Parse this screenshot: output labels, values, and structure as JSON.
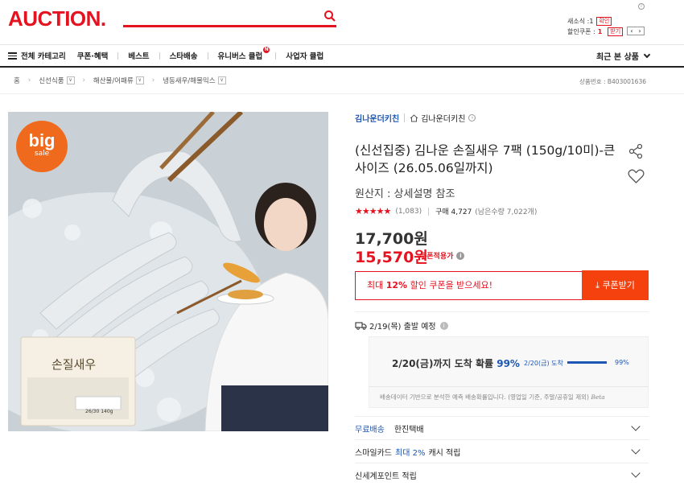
{
  "header": {
    "logo": "AUCTION.",
    "cart_label": "새소식 : ",
    "cart_count": "1",
    "cart_btn": "확인",
    "coupon_label": "할인쿠폰 : ",
    "coupon_count": "1",
    "coupon_btn": "받기"
  },
  "nav": {
    "all_category": "전체 카테고리",
    "items": [
      "쿠폰·혜택",
      "베스트",
      "스타배송",
      "유니버스 클럽",
      "사업자 클럽"
    ],
    "club_badge": "N",
    "recent": "최근 본 상품"
  },
  "breadcrumb": {
    "home": "홈",
    "items": [
      "신선식품",
      "해산물/어패류",
      "냉동새우/해물믹스"
    ],
    "product_no": "상품번호 : B403001636"
  },
  "hero": {
    "badge_big": "big",
    "badge_sale": "sale",
    "package_label": "손질새우",
    "package_sub": "26/30 140g"
  },
  "product": {
    "seller_name": "김나운더키친",
    "store_name": "김나운더키친",
    "title": "(신선집중) 김나운 손질새우 7팩 (150g/10미)-큰사이즈 (26.05.06일까지)",
    "origin": "원산지 : 상세설명 참조",
    "stars": "★★★★★",
    "review_count": "(1,083)",
    "purchase": "구매 4,727",
    "stock": "(남은수량 7,022개)",
    "price": "17,700원",
    "sale_price": "15,570원",
    "coupon_applied": "쿠폰적용가"
  },
  "coupon": {
    "prefix": "최대 ",
    "pct": "12%",
    "suffix": " 할인 쿠폰을 받으세요!",
    "button": "쿠폰받기"
  },
  "shipping": {
    "departure": "2/19(목) 출발 예정",
    "arrival_prefix": "2/20(금)까지 도착 확률 ",
    "arrival_pct": "99%",
    "mini_date": "2/20(금) 도착",
    "mini_pct": "99%",
    "mini_fraction": 0.99,
    "note": "배송데이터 기반으로 분석한 예측 배송확률입니다. (영업일 기준, 주말/공휴일 제외)",
    "beta": "Beta"
  },
  "rows": {
    "free_ship": "무료배송",
    "courier": "한진택배",
    "smile_card": "스마일카드",
    "smile_max": "최대 2%",
    "smile_suffix": "캐시 적립",
    "shinsegae": "신세계포인트 적립"
  },
  "colors": {
    "brand_red": "#e5121f",
    "coupon_orange": "#f4410e",
    "link_blue": "#1e56b4"
  }
}
